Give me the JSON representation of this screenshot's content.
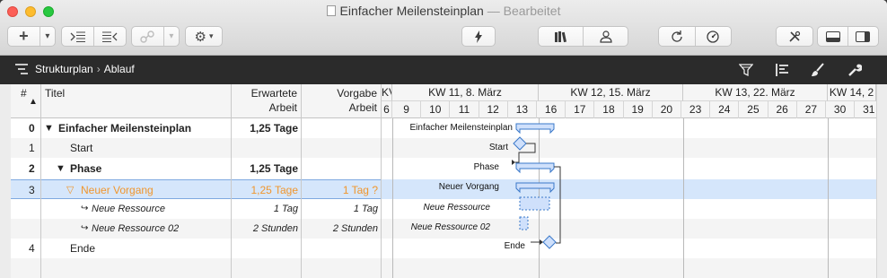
{
  "window": {
    "title": "Einfacher Meilensteinplan",
    "subtitle": "— Bearbeitet"
  },
  "toolbar": {
    "add_icon": "+",
    "chevron": "⌄",
    "outdent_icon": "outdent-icon",
    "indent_icon": "indent-icon",
    "link_icon": "link-icon",
    "gear_icon": "gear-icon",
    "critical_icon": "lightning-icon",
    "library_icon": "library-icon",
    "person_icon": "person-icon",
    "refresh_icon": "refresh-icon",
    "dashboard_icon": "gauge-icon",
    "tools_icon": "tools-icon",
    "bottom_pane_icon": "bottom-pane-icon",
    "side_pane_icon": "side-pane-icon"
  },
  "path": {
    "items": [
      "Strukturplan",
      "Ablauf"
    ],
    "separator": "›"
  },
  "table": {
    "headers": {
      "num": "#",
      "title": "Titel",
      "expected_work": [
        "Erwartete",
        "Arbeit"
      ],
      "target_work": [
        "Vorgabe",
        "Arbeit"
      ]
    },
    "rows": [
      {
        "num": "0",
        "title": "Einfacher Meilensteinplan",
        "expected": "1,25 Tage",
        "target": "",
        "kind": "summary"
      },
      {
        "num": "1",
        "title": "Start",
        "expected": "",
        "target": "",
        "kind": "milestone"
      },
      {
        "num": "2",
        "title": "Phase",
        "expected": "1,25 Tage",
        "target": "",
        "kind": "summary"
      },
      {
        "num": "3",
        "title": "Neuer Vorgang",
        "expected": "1,25 Tage",
        "target": "1 Tag ?",
        "kind": "task"
      },
      {
        "num": "",
        "title": "Neue Ressource",
        "expected": "1 Tag",
        "target": "1 Tag",
        "kind": "resource"
      },
      {
        "num": "",
        "title": "Neue Ressource 02",
        "expected": "2 Stunden",
        "target": "2 Stunden",
        "kind": "resource"
      },
      {
        "num": "4",
        "title": "Ende",
        "expected": "",
        "target": "",
        "kind": "milestone"
      }
    ]
  },
  "gantt": {
    "weeks": [
      "KV",
      "KW 11, 8. März",
      "KW 12, 15. März",
      "KW 13, 22. März",
      "KW 14, 2"
    ],
    "days": [
      "6",
      "9",
      "10",
      "11",
      "12",
      "13",
      "16",
      "17",
      "18",
      "19",
      "20",
      "23",
      "24",
      "25",
      "26",
      "27",
      "30",
      "31"
    ],
    "labels": [
      "Einfacher Meilensteinplan",
      "Start",
      "Phase",
      "Neuer Vorgang",
      "Neue Ressource",
      "Neue Ressource 02",
      "Ende"
    ],
    "colors": {
      "bar_fill": "#cfe0fb",
      "bar_stroke": "#3a78c9",
      "selection": "#d5e6fb",
      "accent_orange": "#f0962d"
    }
  }
}
